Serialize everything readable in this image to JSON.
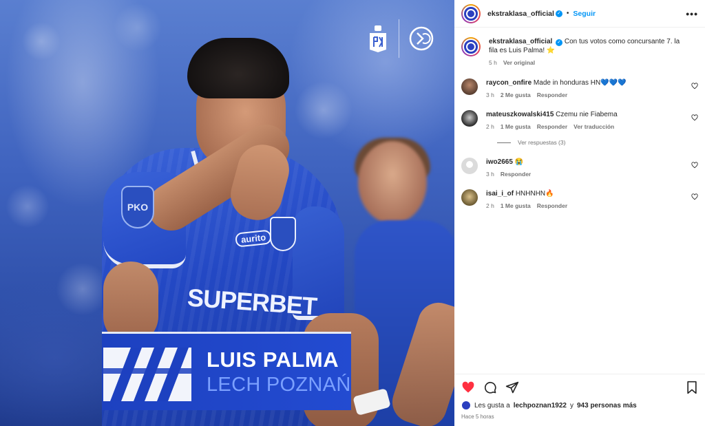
{
  "media": {
    "player_name": "LUIS PALMA",
    "club_name": "LECH POZNAŃ",
    "jersey_sponsor": "SUPERBET",
    "sleeve_sponsor": "aurito",
    "patch_text": "PKO"
  },
  "post_header": {
    "username": "ekstraklasa_official",
    "separator": "•",
    "follow_label": "Seguir",
    "more_label": "•••"
  },
  "caption": {
    "username": "ekstraklasa_official",
    "text": "Con tus votos como concursante 7. la fila es Luis Palma! ⭐",
    "time": "5 h",
    "see_original": "Ver original"
  },
  "comments": [
    {
      "username": "raycon_onfire",
      "text": "Made in honduras HN💙💙💙",
      "time": "3 h",
      "likes": "2 Me gusta",
      "reply": "Responder"
    },
    {
      "username": "mateuszkowalski415",
      "text": "Czemu nie Fiabema",
      "time": "2 h",
      "likes": "1 Me gusta",
      "reply": "Responder",
      "translate": "Ver traducción",
      "view_replies": "Ver respuestas (3)"
    },
    {
      "username": "iwo2665",
      "text": "😭",
      "time": "3 h",
      "reply": "Responder"
    },
    {
      "username": "isai_i_of",
      "text": "HNHNHN🔥",
      "time": "2 h",
      "likes": "1 Me gusta",
      "reply": "Responder"
    }
  ],
  "likes": {
    "prefix": "Les gusta a",
    "user": "lechpoznan1922",
    "middle": "y",
    "others": "943 personas más"
  },
  "posted_ago": "Hace 5 horas",
  "colors": {
    "accent": "#0095f6",
    "like_red": "#ff3040",
    "banner_blue": "#1d41c0",
    "club_text": "#7ba0ff"
  }
}
